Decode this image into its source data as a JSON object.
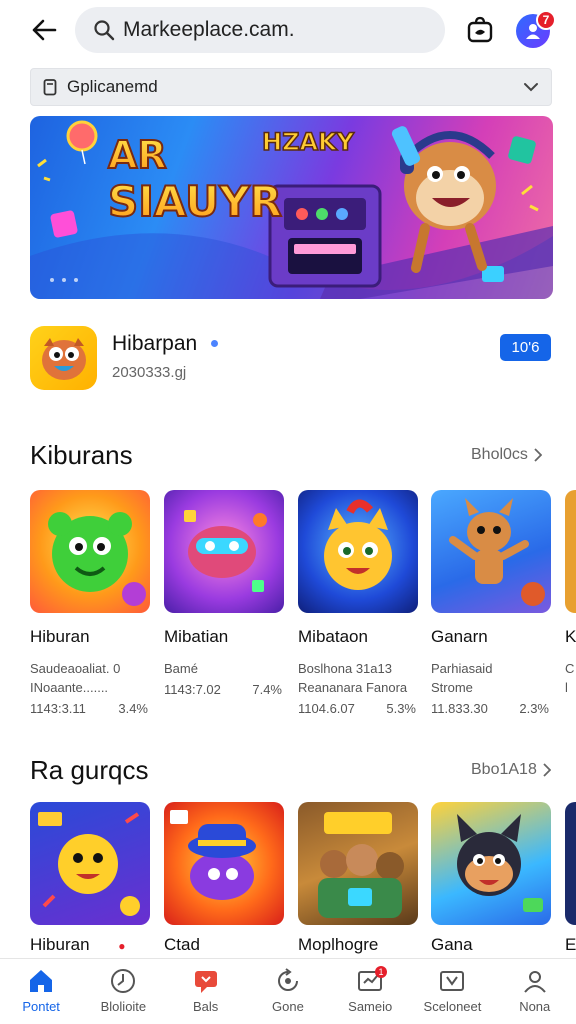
{
  "header": {
    "search_value": "Markeeplace.cam.",
    "notif_count": "7",
    "icons": {
      "back": "arrow-left-icon",
      "search": "magnifier-icon",
      "bag": "shopping-bag-icon",
      "avatar": "profile-avatar-icon"
    }
  },
  "category_select": {
    "selected": "Gplicanemd"
  },
  "banner": {
    "line1": "AR",
    "line2": "SIAUYR",
    "tag": "HZAKY"
  },
  "featured_app": {
    "title": "Hibarpan",
    "subtitle": "2030333.gj",
    "action_label": "10'6"
  },
  "section1": {
    "title": "Kiburans",
    "more_label": "Bhol0cs",
    "cards": [
      {
        "name": "Hiburan",
        "desc1": "Saudeaoaliat. 0",
        "desc2": "INoaante.......",
        "size": "1143:3.11",
        "rating": "3.4%",
        "art": "green-bear"
      },
      {
        "name": "Mibatian",
        "desc1": "Bamé",
        "desc2": "",
        "size": "1143:7.02",
        "rating": "7.4%",
        "art": "pink-robot"
      },
      {
        "name": "Mibataon",
        "desc1": "Boslhona  31a13",
        "desc2": "Reananara Fanora",
        "size": "1104.6.07",
        "rating": "5.3%",
        "art": "yellow-cat"
      },
      {
        "name": "Ganarn",
        "desc1": "Parhiasaid",
        "desc2": "Strome",
        "size": "11.833.30",
        "rating": "2.3%",
        "art": "fox-dancer"
      },
      {
        "name": "K",
        "desc1": "C",
        "desc2": "l",
        "size": "",
        "rating": "",
        "art": "partial"
      }
    ]
  },
  "section2": {
    "title": "Ra gurqcs",
    "more_label": "Bbo1A18",
    "cards": [
      {
        "name": "Hiburan",
        "art": "emoji-star"
      },
      {
        "name": "Ctad",
        "art": "hat-blob"
      },
      {
        "name": "Moplhogre",
        "art": "party-crew"
      },
      {
        "name": "Gana",
        "art": "wolf-pup"
      },
      {
        "name": "E",
        "art": "partial"
      }
    ]
  },
  "bottom_nav": [
    {
      "label": "Pontet",
      "icon": "home-icon",
      "active": true
    },
    {
      "label": "Blolioite",
      "icon": "clock-icon",
      "active": false
    },
    {
      "label": "Bals",
      "icon": "message-icon",
      "active": false
    },
    {
      "label": "Gone",
      "icon": "refresh-icon",
      "active": false
    },
    {
      "label": "Sameio",
      "icon": "inbox-icon",
      "active": false,
      "badge": "1"
    },
    {
      "label": "Sceloneet",
      "icon": "chart-icon",
      "active": false
    },
    {
      "label": "Nona",
      "icon": "person-icon",
      "active": false
    }
  ],
  "colors": {
    "accent": "#1565e8",
    "badge": "#e51f2b"
  }
}
